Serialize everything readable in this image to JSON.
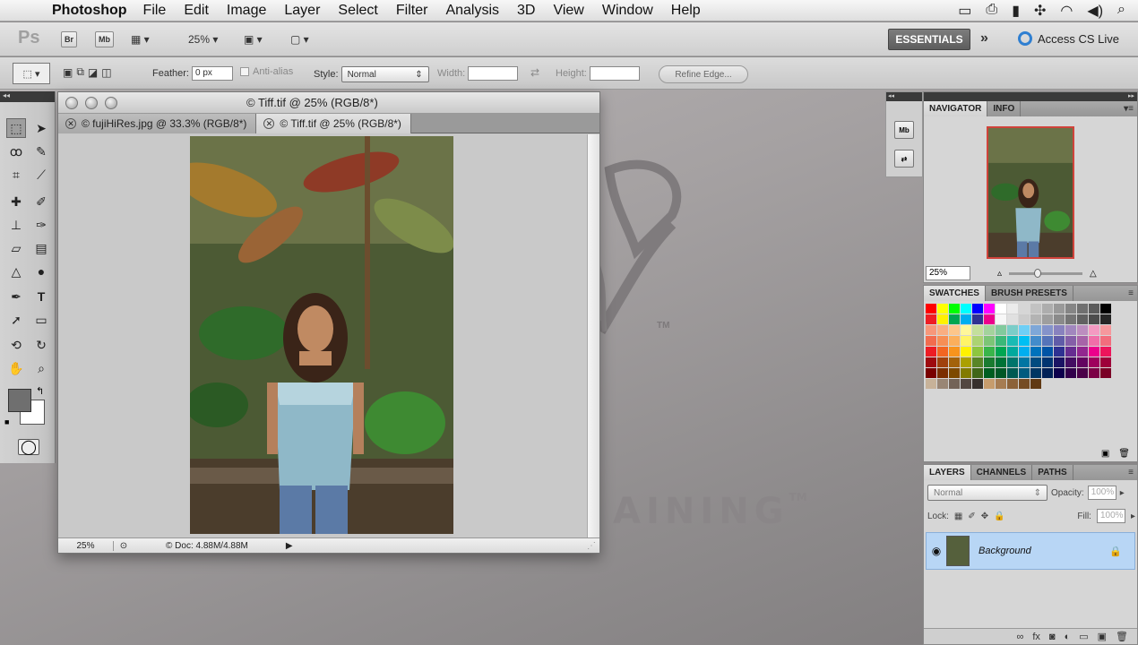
{
  "menubar": {
    "app_name": "Photoshop",
    "menus": [
      "File",
      "Edit",
      "Image",
      "Layer",
      "Select",
      "Filter",
      "Analysis",
      "3D",
      "View",
      "Window",
      "Help"
    ],
    "status_icons": [
      "camera-icon",
      "printer-icon",
      "battery-icon",
      "bluetooth-icon",
      "wifi-icon",
      "volume-icon",
      "search-icon"
    ]
  },
  "appbar": {
    "logo": "Ps",
    "bridge_label": "Br",
    "minibridge_label": "Mb",
    "zoom": "25%",
    "workspace": "ESSENTIALS",
    "access_cs_live": "Access CS Live"
  },
  "options": {
    "feather_label": "Feather:",
    "feather_value": "0 px",
    "antialias_label": "Anti-alias",
    "style_label": "Style:",
    "style_value": "Normal",
    "width_label": "Width:",
    "height_label": "Height:",
    "refine_edge": "Refine Edge..."
  },
  "document": {
    "window_title": "© Tiff.tif @ 25% (RGB/8*)",
    "tabs": [
      {
        "label": "© fujiHiRes.jpg @ 33.3% (RGB/8*)",
        "active": false
      },
      {
        "label": "© Tiff.tif @ 25% (RGB/8*)",
        "active": true
      }
    ],
    "status_zoom": "25%",
    "status_doc": "Doc: 4.88M/4.88M"
  },
  "panels": {
    "navigator_tab": "NAVIGATOR",
    "info_tab": "INFO",
    "nav_zoom": "25%",
    "swatches_tab": "SWATCHES",
    "brush_presets_tab": "BRUSH PRESETS",
    "layers_tab": "LAYERS",
    "channels_tab": "CHANNELS",
    "paths_tab": "PATHS",
    "blend_mode": "Normal",
    "opacity_label": "Opacity:",
    "opacity_value": "100%",
    "lock_label": "Lock:",
    "fill_label": "Fill:",
    "fill_value": "100%",
    "layer_name": "Background"
  },
  "desktop": {
    "training_text": "AINING",
    "tm": "TM"
  },
  "colors": {
    "foreground": "#6f6f6f",
    "background": "#ffffff",
    "nav_frame": "#d0433b",
    "layer_selected": "#b8d6f5"
  }
}
